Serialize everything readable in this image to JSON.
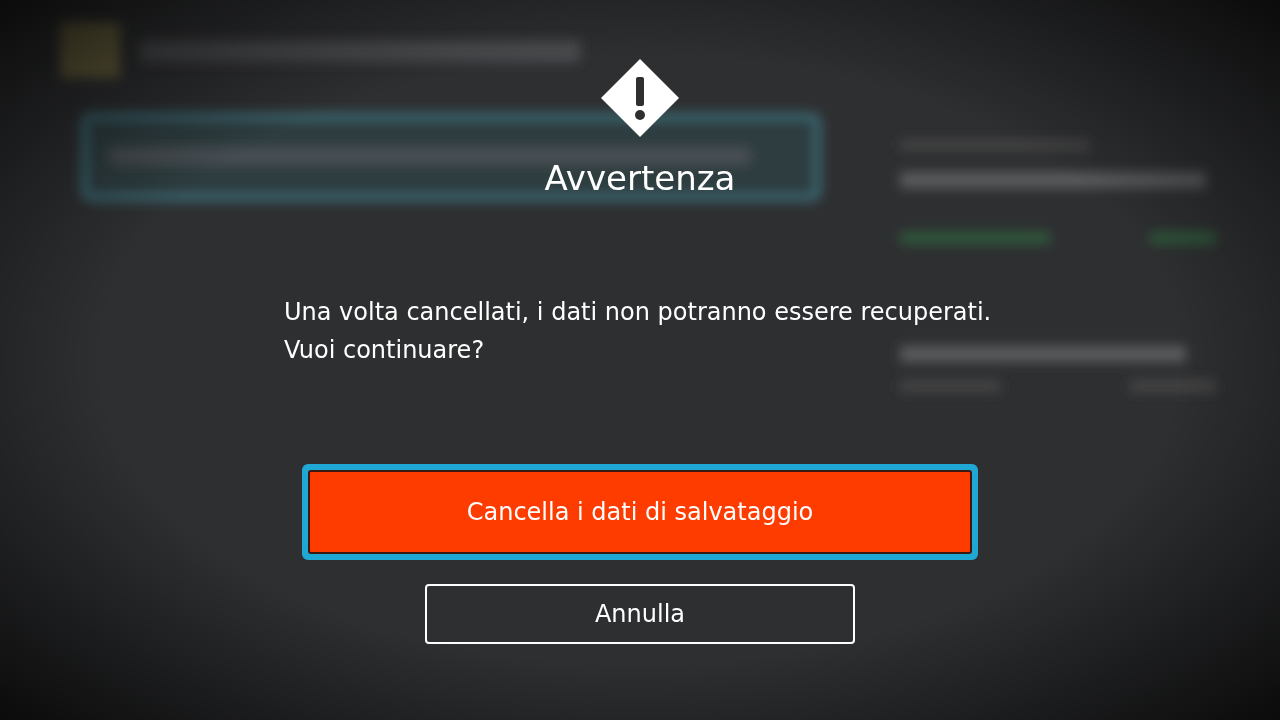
{
  "dialog": {
    "title": "Avvertenza",
    "message": [
      "Una volta cancellati, i dati non potranno essere recuperati.",
      "Vuoi continuare?"
    ],
    "buttons": [
      {
        "label": "Cancella i dati di salvataggio",
        "kind": "danger",
        "selected": true
      },
      {
        "label": "Annulla",
        "kind": "outline",
        "selected": false
      }
    ]
  }
}
